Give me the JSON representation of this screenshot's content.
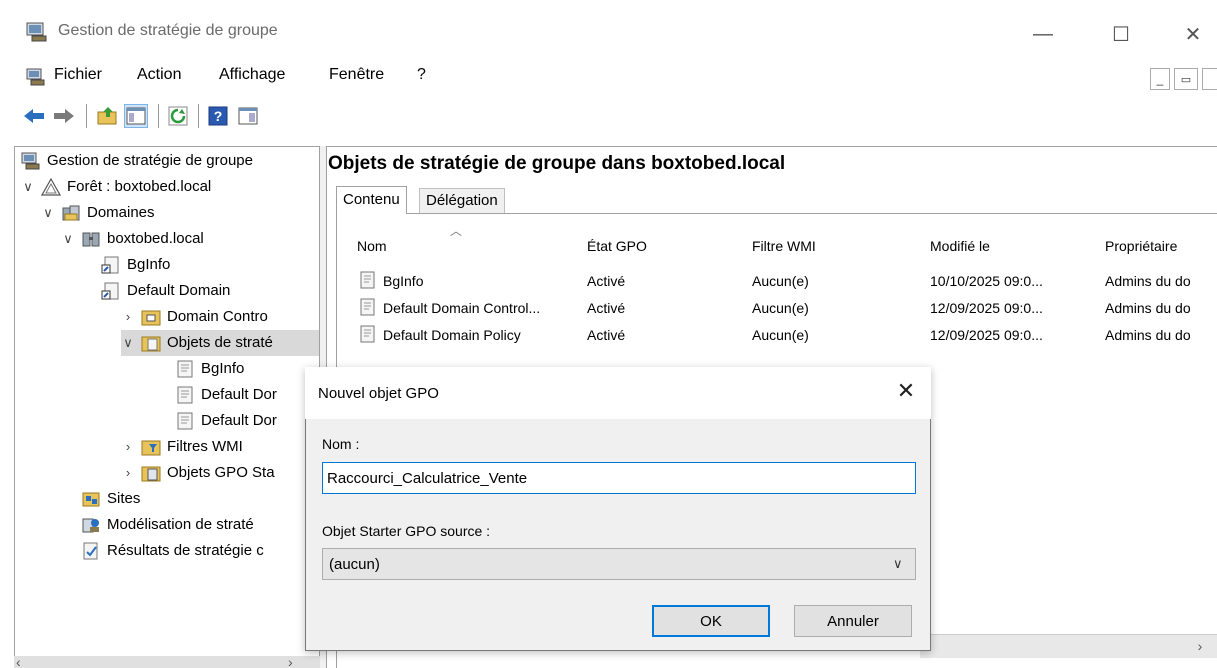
{
  "window": {
    "title": "Gestion de stratégie de groupe",
    "controls": {
      "minimize": "—",
      "maximize": "☐",
      "close": "✕"
    }
  },
  "menubar": {
    "items": [
      "Fichier",
      "Action",
      "Affichage",
      "Fenêtre",
      "?"
    ]
  },
  "toolbar": {
    "icons": [
      "back-arrow-icon",
      "forward-arrow-icon",
      "up-folder-icon",
      "show-hide-tree-icon",
      "refresh-icon",
      "help-icon",
      "console-view-icon"
    ]
  },
  "tree": {
    "root": "Gestion de stratégie de groupe",
    "forest": "Forêt : boxtobed.local",
    "domains": "Domaines",
    "domain": "boxtobed.local",
    "items": [
      {
        "label": "BgInfo"
      },
      {
        "label": "Default Domain"
      },
      {
        "label": "Domain Contro"
      },
      {
        "label": "Objets de straté"
      },
      {
        "label": "BgInfo"
      },
      {
        "label": "Default Dor"
      },
      {
        "label": "Default Dor"
      },
      {
        "label": "Filtres WMI"
      },
      {
        "label": "Objets GPO Sta"
      }
    ],
    "sites": "Sites",
    "modeling": "Modélisation de straté",
    "results": "Résultats de stratégie c"
  },
  "right": {
    "title": "Objets de stratégie de groupe dans boxtobed.local",
    "tabs": [
      "Contenu",
      "Délégation"
    ],
    "columns": [
      "Nom",
      "État GPO",
      "Filtre WMI",
      "Modifié le",
      "Propriétaire"
    ],
    "rows": [
      {
        "name": "BgInfo",
        "state": "Activé",
        "wmi": "Aucun(e)",
        "modified": "10/10/2025 09:0...",
        "owner": "Admins du do"
      },
      {
        "name": "Default Domain Control...",
        "state": "Activé",
        "wmi": "Aucun(e)",
        "modified": "12/09/2025 09:0...",
        "owner": "Admins du do"
      },
      {
        "name": "Default Domain Policy",
        "state": "Activé",
        "wmi": "Aucun(e)",
        "modified": "12/09/2025 09:0...",
        "owner": "Admins du do"
      }
    ]
  },
  "dialog": {
    "title": "Nouvel objet GPO",
    "close": "✕",
    "name_label": "Nom :",
    "name_value": "Raccourci_Calculatrice_Vente",
    "starter_label": "Objet Starter GPO source :",
    "starter_value": "(aucun)",
    "ok": "OK",
    "cancel": "Annuler"
  },
  "colors": {
    "accent": "#0078d7",
    "selected_row": "#d9d9d9",
    "dialog_bg": "#f0f0f0"
  }
}
